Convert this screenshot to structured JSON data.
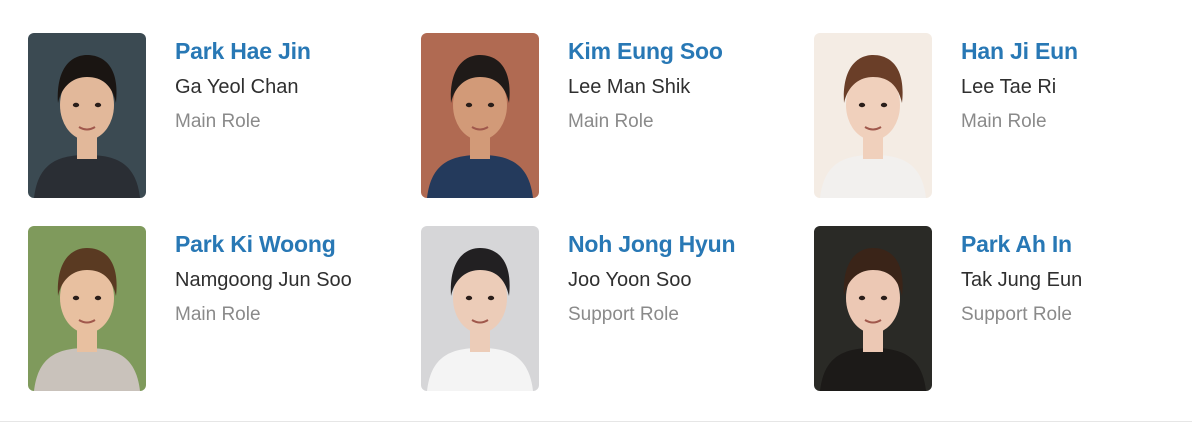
{
  "cast": [
    {
      "actor": "Park Hae Jin",
      "character": "Ga Yeol Chan",
      "role": "Main Role",
      "bg": "#3b4a52",
      "hair": "#1a1512",
      "skin": "#e2b89a",
      "shirt": "#2a2e34"
    },
    {
      "actor": "Kim Eung Soo",
      "character": "Lee Man Shik",
      "role": "Main Role",
      "bg": "#b06a52",
      "hair": "#1f1a18",
      "skin": "#d29a78",
      "shirt": "#243a5c"
    },
    {
      "actor": "Han Ji Eun",
      "character": "Lee Tae Ri",
      "role": "Main Role",
      "bg": "#f4ece4",
      "hair": "#6a3e28",
      "skin": "#f0d0bc",
      "shirt": "#f2f0ee"
    },
    {
      "actor": "Park Ki Woong",
      "character": "Namgoong Jun Soo",
      "role": "Main Role",
      "bg": "#7f9a5c",
      "hair": "#5a3a22",
      "skin": "#e8c0a0",
      "shirt": "#c9c2bb"
    },
    {
      "actor": "Noh Jong Hyun",
      "character": "Joo Yoon Soo",
      "role": "Support Role",
      "bg": "#d6d6d8",
      "hair": "#222022",
      "skin": "#ecccb8",
      "shirt": "#f4f4f4"
    },
    {
      "actor": "Park Ah In",
      "character": "Tak Jung Eun",
      "role": "Support Role",
      "bg": "#2a2a26",
      "hair": "#3a2418",
      "skin": "#ecc8b4",
      "shirt": "#1c1a18"
    }
  ]
}
